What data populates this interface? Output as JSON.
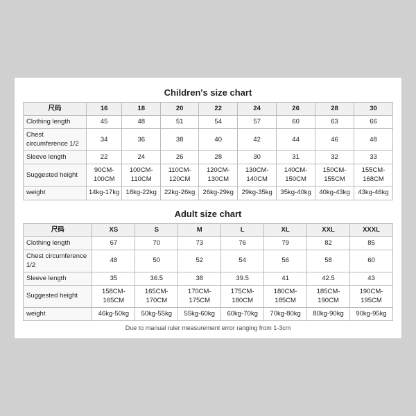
{
  "children_chart": {
    "title": "Children's size chart",
    "headers": [
      "尺码",
      "16",
      "18",
      "20",
      "22",
      "24",
      "26",
      "28",
      "30"
    ],
    "rows": [
      {
        "label": "Clothing length",
        "values": [
          "45",
          "48",
          "51",
          "54",
          "57",
          "60",
          "63",
          "66"
        ]
      },
      {
        "label": "Chest circumference 1/2",
        "values": [
          "34",
          "36",
          "38",
          "40",
          "42",
          "44",
          "46",
          "48"
        ]
      },
      {
        "label": "Sleeve length",
        "values": [
          "22",
          "24",
          "26",
          "28",
          "30",
          "31",
          "32",
          "33"
        ]
      },
      {
        "label": "Suggested height",
        "values": [
          "90CM-100CM",
          "100CM-110CM",
          "110CM-120CM",
          "120CM-130CM",
          "130CM-140CM",
          "140CM-150CM",
          "150CM-155CM",
          "155CM-168CM"
        ]
      },
      {
        "label": "weight",
        "values": [
          "14kg-17kg",
          "18kg-22kg",
          "22kg-26kg",
          "26kg-29kg",
          "29kg-35kg",
          "35kg-40kg",
          "40kg-43kg",
          "43kg-46kg"
        ]
      }
    ]
  },
  "adult_chart": {
    "title": "Adult size chart",
    "headers": [
      "尺码",
      "XS",
      "S",
      "M",
      "L",
      "XL",
      "XXL",
      "XXXL"
    ],
    "rows": [
      {
        "label": "Clothing length",
        "values": [
          "67",
          "70",
          "73",
          "76",
          "79",
          "82",
          "85"
        ]
      },
      {
        "label": "Chest circumference 1/2",
        "values": [
          "48",
          "50",
          "52",
          "54",
          "56",
          "58",
          "60"
        ]
      },
      {
        "label": "Sleeve length",
        "values": [
          "35",
          "36.5",
          "38",
          "39.5",
          "41",
          "42.5",
          "43"
        ]
      },
      {
        "label": "Suggested height",
        "values": [
          "158CM-165CM",
          "165CM-170CM",
          "170CM-175CM",
          "175CM-180CM",
          "180CM-185CM",
          "185CM-190CM",
          "190CM-195CM"
        ]
      },
      {
        "label": "weight",
        "values": [
          "46kg-50kg",
          "50kg-55kg",
          "55kg-60kg",
          "60kg-70kg",
          "70kg-80kg",
          "80kg-90kg",
          "90kg-95kg"
        ]
      }
    ]
  },
  "footnote": "Due to manual ruler measurement error ranging from 1-3cm"
}
